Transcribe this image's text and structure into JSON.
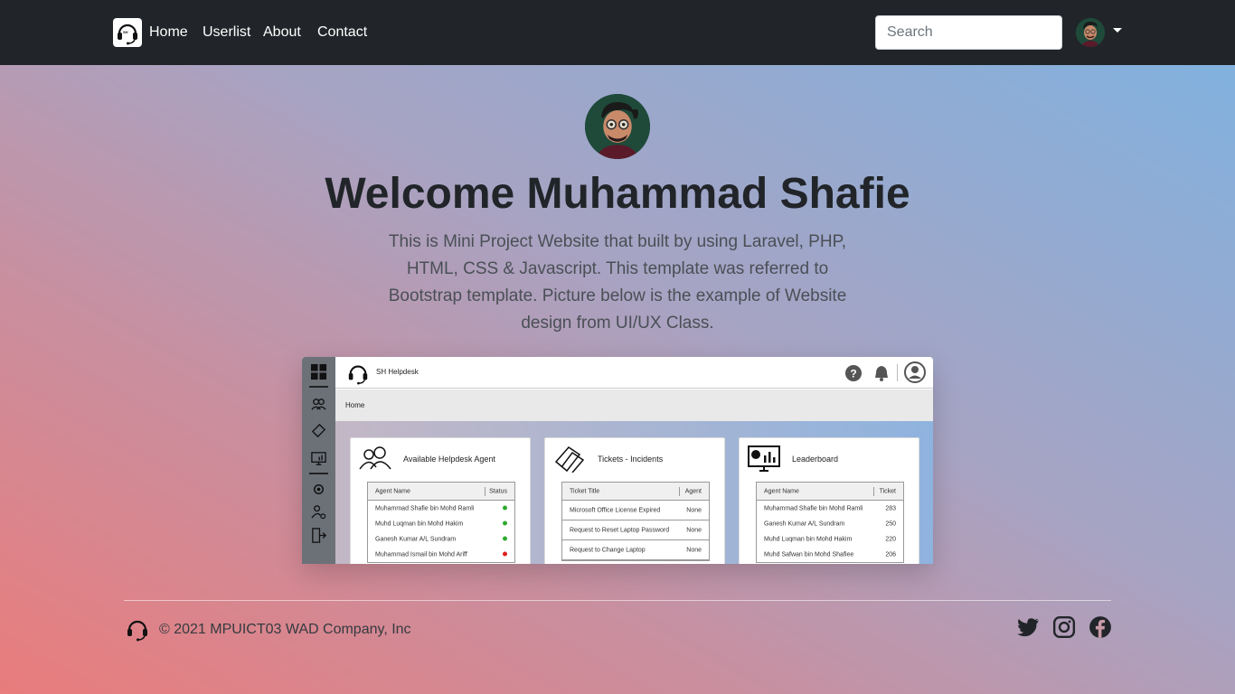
{
  "navbar": {
    "links": [
      "Home",
      "Userlist",
      "About",
      "Contact"
    ],
    "search_placeholder": "Search",
    "logo_icon": "helpdesk-headset-icon",
    "avatar_icon": "user-avatar"
  },
  "hero": {
    "title": "Welcome Muhammad Shafie",
    "lead": "This is Mini Project Website that built by using Laravel, PHP, HTML, CSS & Javascript. This template was referred to Bootstrap template. Picture below is the example of Website design from UI/UX Class."
  },
  "preview": {
    "brand": "SH Helpdesk",
    "breadcrumb": "Home",
    "cards": [
      {
        "title": "Available Helpdesk Agent",
        "col1": "Agent Name",
        "col2": "Status",
        "rows": [
          {
            "name": "Muhammad Shafie bin Mohd Ramli",
            "status": "online"
          },
          {
            "name": "Muhd Luqman bin Mohd Hakim",
            "status": "online"
          },
          {
            "name": "Ganesh Kumar A/L Sundram",
            "status": "online"
          },
          {
            "name": "Muhammad Ismail bin Mohd Ariff",
            "status": "offline"
          }
        ]
      },
      {
        "title": "Tickets - Incidents",
        "col1": "Ticket Title",
        "col2": "Agent",
        "rows": [
          {
            "name": "Microsoft Office License Expired",
            "value": "None"
          },
          {
            "name": "Request to Reset Laptop Password",
            "value": "None"
          },
          {
            "name": "Request to Change Laptop",
            "value": "None"
          }
        ]
      },
      {
        "title": "Leaderboard",
        "col1": "Agent Name",
        "col2": "Ticket",
        "rows": [
          {
            "name": "Muhammad Shafie bin Mohd Ramli",
            "value": "283"
          },
          {
            "name": "Ganesh Kumar A/L Sundram",
            "value": "250"
          },
          {
            "name": "Muhd Luqman bin Mohd Hakim",
            "value": "220"
          },
          {
            "name": "Muhd Safwan bin Mohd Shafiee",
            "value": "206"
          }
        ]
      }
    ],
    "colors": {
      "online": "#2eaa2e",
      "offline": "#e02020"
    }
  },
  "footer": {
    "copyright": "© 2021 MPUICT03 WAD Company, Inc",
    "social": [
      "twitter-icon",
      "instagram-icon",
      "facebook-icon"
    ]
  }
}
